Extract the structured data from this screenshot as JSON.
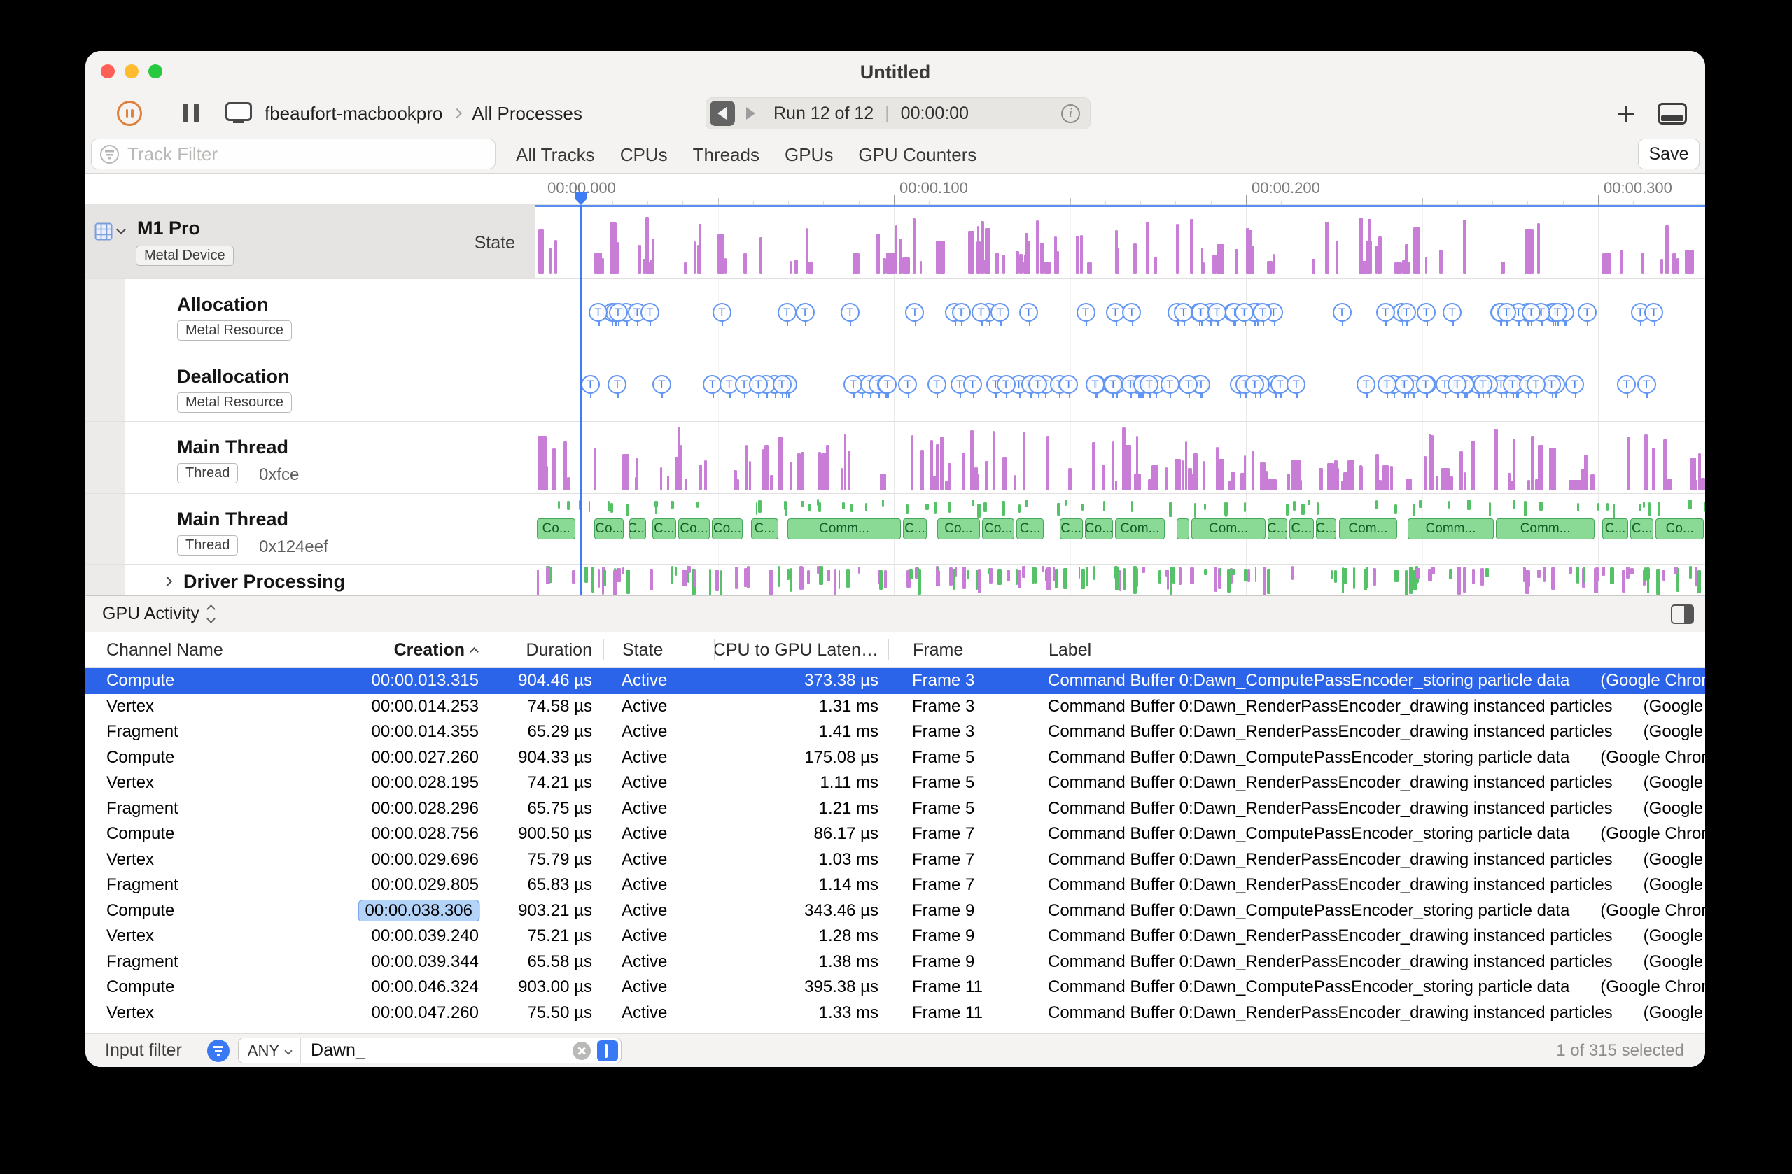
{
  "titlebar": {
    "title": "Untitled"
  },
  "toolbar": {
    "device": "fbeaufort-macbookpro",
    "scope": "All Processes",
    "run_label": "Run 12 of 12",
    "run_time": "00:00:00",
    "plus": "+"
  },
  "filter_bar": {
    "placeholder": "Track Filter",
    "tabs": [
      "All Tracks",
      "CPUs",
      "Threads",
      "GPUs",
      "GPU Counters"
    ],
    "save": "Save"
  },
  "ruler_ticks": [
    "00:00.000",
    "00:00.100",
    "00:00.200",
    "00:00.300"
  ],
  "tracks": [
    {
      "name": "M1 Pro",
      "tag": "Metal Device",
      "state_label": "State"
    },
    {
      "name": "Allocation",
      "tag": "Metal Resource"
    },
    {
      "name": "Deallocation",
      "tag": "Metal Resource"
    },
    {
      "name": "Main Thread",
      "tag": "Thread",
      "value": "0xfce"
    },
    {
      "name": "Main Thread",
      "tag": "Thread",
      "value": "0x124eef"
    },
    {
      "name": "Driver Processing"
    }
  ],
  "timeline": {
    "marker_glyph": "T",
    "block_labels": [
      "C...",
      "Co...",
      "Com...",
      "Comm..."
    ],
    "colors": {
      "bar_purple": "#c87ed6",
      "block_green": "#8ada95",
      "tick_green": "#55c268",
      "marker_blue": "#4f86ee",
      "playhead_blue": "#3f7cf3"
    }
  },
  "detail": {
    "selector": "GPU Activity",
    "columns": [
      "Channel Name",
      "Creation",
      "Duration",
      "State",
      "CPU to GPU Laten…",
      "Frame",
      "Label"
    ],
    "rows": [
      {
        "channel": "Compute",
        "creation": "00:00.013.315",
        "duration": "904.46 µs",
        "state": "Active",
        "latency": "373.38 µs",
        "frame": "Frame 3",
        "label": "Command Buffer 0:Dawn_ComputePassEncoder_storing particle data",
        "source": "(Google Chrome He",
        "selected": true
      },
      {
        "channel": "Vertex",
        "creation": "00:00.014.253",
        "duration": "74.58 µs",
        "state": "Active",
        "latency": "1.31 ms",
        "frame": "Frame 3",
        "label": "Command Buffer 0:Dawn_RenderPassEncoder_drawing instanced particles",
        "source": "(Google Chro"
      },
      {
        "channel": "Fragment",
        "creation": "00:00.014.355",
        "duration": "65.29 µs",
        "state": "Active",
        "latency": "1.41 ms",
        "frame": "Frame 3",
        "label": "Command Buffer 0:Dawn_RenderPassEncoder_drawing instanced particles",
        "source": "(Google Chro"
      },
      {
        "channel": "Compute",
        "creation": "00:00.027.260",
        "duration": "904.33 µs",
        "state": "Active",
        "latency": "175.08 µs",
        "frame": "Frame 5",
        "label": "Command Buffer 0:Dawn_ComputePassEncoder_storing particle data",
        "source": "(Google Chrome He"
      },
      {
        "channel": "Vertex",
        "creation": "00:00.028.195",
        "duration": "74.21 µs",
        "state": "Active",
        "latency": "1.11 ms",
        "frame": "Frame 5",
        "label": "Command Buffer 0:Dawn_RenderPassEncoder_drawing instanced particles",
        "source": "(Google Chro"
      },
      {
        "channel": "Fragment",
        "creation": "00:00.028.296",
        "duration": "65.75 µs",
        "state": "Active",
        "latency": "1.21 ms",
        "frame": "Frame 5",
        "label": "Command Buffer 0:Dawn_RenderPassEncoder_drawing instanced particles",
        "source": "(Google Chro"
      },
      {
        "channel": "Compute",
        "creation": "00:00.028.756",
        "duration": "900.50 µs",
        "state": "Active",
        "latency": "86.17 µs",
        "frame": "Frame 7",
        "label": "Command Buffer 0:Dawn_ComputePassEncoder_storing particle data",
        "source": "(Google Chrome He"
      },
      {
        "channel": "Vertex",
        "creation": "00:00.029.696",
        "duration": "75.79 µs",
        "state": "Active",
        "latency": "1.03 ms",
        "frame": "Frame 7",
        "label": "Command Buffer 0:Dawn_RenderPassEncoder_drawing instanced particles",
        "source": "(Google Chro"
      },
      {
        "channel": "Fragment",
        "creation": "00:00.029.805",
        "duration": "65.83 µs",
        "state": "Active",
        "latency": "1.14 ms",
        "frame": "Frame 7",
        "label": "Command Buffer 0:Dawn_RenderPassEncoder_drawing instanced particles",
        "source": "(Google Chro"
      },
      {
        "channel": "Compute",
        "creation": "00:00.038.306",
        "duration": "903.21 µs",
        "state": "Active",
        "latency": "343.46 µs",
        "frame": "Frame 9",
        "label": "Command Buffer 0:Dawn_ComputePassEncoder_storing particle data",
        "source": "(Google Chrome He",
        "creation_highlight": true
      },
      {
        "channel": "Vertex",
        "creation": "00:00.039.240",
        "duration": "75.21 µs",
        "state": "Active",
        "latency": "1.28 ms",
        "frame": "Frame 9",
        "label": "Command Buffer 0:Dawn_RenderPassEncoder_drawing instanced particles",
        "source": "(Google Chro"
      },
      {
        "channel": "Fragment",
        "creation": "00:00.039.344",
        "duration": "65.58 µs",
        "state": "Active",
        "latency": "1.38 ms",
        "frame": "Frame 9",
        "label": "Command Buffer 0:Dawn_RenderPassEncoder_drawing instanced particles",
        "source": "(Google Chro"
      },
      {
        "channel": "Compute",
        "creation": "00:00.046.324",
        "duration": "903.00 µs",
        "state": "Active",
        "latency": "395.38 µs",
        "frame": "Frame 11",
        "label": "Command Buffer 0:Dawn_ComputePassEncoder_storing particle data",
        "source": "(Google Chrome He"
      },
      {
        "channel": "Vertex",
        "creation": "00:00.047.260",
        "duration": "75.50 µs",
        "state": "Active",
        "latency": "1.33 ms",
        "frame": "Frame 11",
        "label": "Command Buffer 0:Dawn_RenderPassEncoder_drawing instanced particles",
        "source": "(Google Chro"
      }
    ],
    "footer": {
      "label": "Input filter",
      "match": "ANY",
      "query": "Dawn_",
      "status": "1 of 315 selected"
    }
  }
}
